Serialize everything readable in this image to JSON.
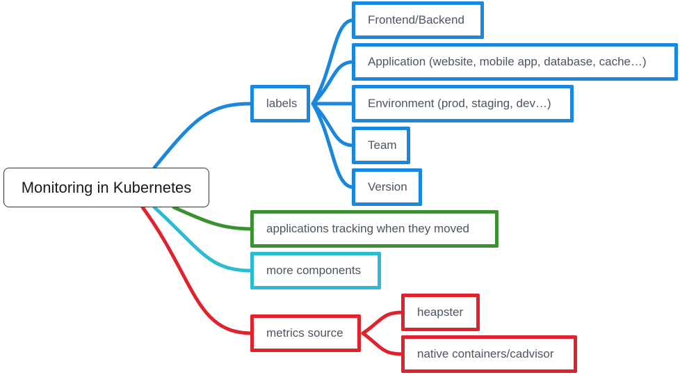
{
  "root": {
    "label": "Monitoring in Kubernetes"
  },
  "colors": {
    "blue": "#1a87dc",
    "green": "#3b9132",
    "cyan": "#2bbcd4",
    "red": "#e0222d",
    "root_border": "#333333",
    "text": "#4a5563"
  },
  "branches": {
    "labels": {
      "label": "labels",
      "color": "blue",
      "children": [
        {
          "label": "Frontend/Backend"
        },
        {
          "label": "Application (website, mobile app, database, cache…)"
        },
        {
          "label": "Environment (prod, staging, dev…)"
        },
        {
          "label": "Team"
        },
        {
          "label": "Version"
        }
      ]
    },
    "tracking": {
      "label": "applications tracking when they moved",
      "color": "green"
    },
    "components": {
      "label": "more components",
      "color": "cyan"
    },
    "metrics": {
      "label": "metrics source",
      "color": "red",
      "children": [
        {
          "label": "heapster"
        },
        {
          "label": "native containers/cadvisor"
        }
      ]
    }
  }
}
